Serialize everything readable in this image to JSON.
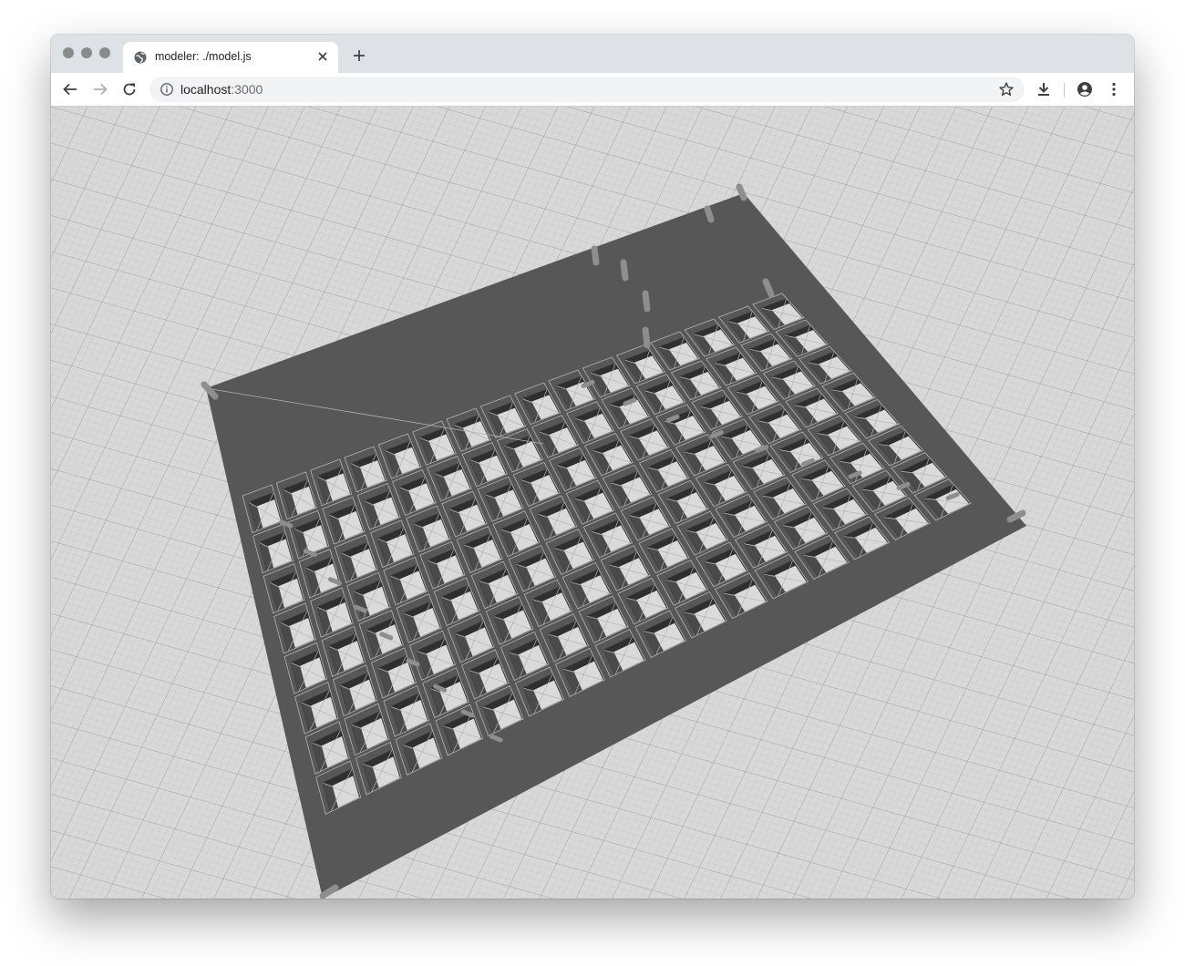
{
  "window": {
    "traffic_lights": [
      "close",
      "minimize",
      "zoom"
    ]
  },
  "tab": {
    "title": "modeler: ./model.js",
    "favicon": "globe-icon",
    "close_icon": "close-icon"
  },
  "toolbar": {
    "back_icon": "back-arrow-icon",
    "forward_icon": "forward-arrow-icon",
    "reload_icon": "reload-icon",
    "url_host": "localhost",
    "url_port": ":3000",
    "bookmark_icon": "star-icon",
    "download_icon": "download-icon",
    "profile_icon": "account-icon",
    "menu_icon": "more-vertical-icon"
  },
  "viewport": {
    "ground_color": "#d8d8d8",
    "grid_color": "#a9a9a9",
    "plate_color": "#575757",
    "cell_color": "#dadada",
    "wire_color": "#b4b4b4",
    "post_color": "#8e8e8e"
  },
  "model": {
    "grid_rows": 8,
    "grid_cols": 16
  }
}
